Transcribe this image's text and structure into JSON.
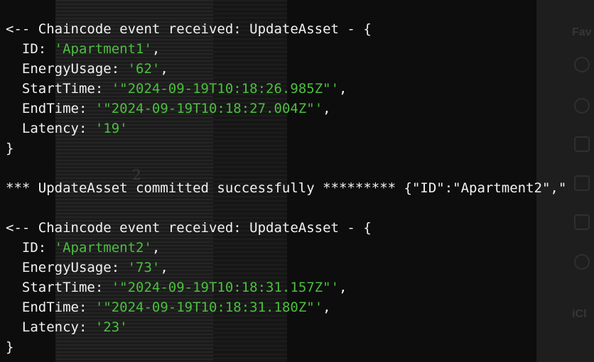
{
  "background": {
    "page_number": "2",
    "finder_heading": "Fav",
    "finder_icloud": "iCl",
    "finder_icons": [
      "airdrop-icon",
      "recents-icon",
      "applications-icon",
      "documents-icon",
      "home-icon",
      "downloads-icon"
    ]
  },
  "terminal": {
    "colors": {
      "background": "#0d0d0d",
      "text": "#f2f2f2",
      "string": "#4cbf3f"
    },
    "event1": {
      "header": "<-- Chaincode event received: UpdateAsset - {",
      "fields": [
        {
          "key": "  ID: ",
          "value": "'Apartment1'",
          "suffix": ","
        },
        {
          "key": "  EnergyUsage: ",
          "value": "'62'",
          "suffix": ","
        },
        {
          "key": "  StartTime: ",
          "value": "'\"2024-09-19T10:18:26.985Z\"'",
          "suffix": ","
        },
        {
          "key": "  EndTime: ",
          "value": "'\"2024-09-19T10:18:27.004Z\"'",
          "suffix": ","
        },
        {
          "key": "  Latency: ",
          "value": "'19'",
          "suffix": ""
        }
      ],
      "close": "}"
    },
    "commit_line": "*** UpdateAsset committed successfully ********* {\"ID\":\"Apartment2\",\"",
    "event2": {
      "header": "<-- Chaincode event received: UpdateAsset - {",
      "fields": [
        {
          "key": "  ID: ",
          "value": "'Apartment2'",
          "suffix": ","
        },
        {
          "key": "  EnergyUsage: ",
          "value": "'73'",
          "suffix": ","
        },
        {
          "key": "  StartTime: ",
          "value": "'\"2024-09-19T10:18:31.157Z\"'",
          "suffix": ","
        },
        {
          "key": "  EndTime: ",
          "value": "'\"2024-09-19T10:18:31.180Z\"'",
          "suffix": ","
        },
        {
          "key": "  Latency: ",
          "value": "'23'",
          "suffix": ""
        }
      ],
      "close": "}"
    }
  }
}
